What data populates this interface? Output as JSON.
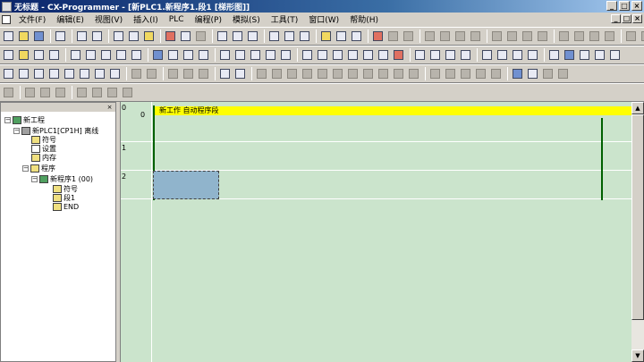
{
  "window": {
    "title": "无标题 - CX-Programmer - [新PLC1.新程序1.段1 [梯形图]]",
    "buttons": [
      "_",
      "□",
      "×"
    ]
  },
  "menubar": {
    "items": [
      "文件(F)",
      "编辑(E)",
      "视图(V)",
      "插入(I)",
      "PLC",
      "编程(P)",
      "模拟(S)",
      "工具(T)",
      "窗口(W)",
      "帮助(H)"
    ]
  },
  "tree": {
    "close_label": "×",
    "root": "新工程",
    "plc": "新PLC1[CP1H] 离线",
    "symbols": "符号",
    "settings": "设置",
    "memory": "内存",
    "programs": "程序",
    "program1": "新程序1 (00)",
    "prog_symbols": "符号",
    "section1": "段1",
    "end": "END"
  },
  "ladder": {
    "rungs": [
      {
        "number": "0",
        "step": "0"
      },
      {
        "number": "1",
        "step": ""
      },
      {
        "number": "2",
        "step": ""
      }
    ],
    "comment": "新工作 自动程序段"
  },
  "scrollbar": {
    "up": "▲",
    "down": "▼"
  }
}
